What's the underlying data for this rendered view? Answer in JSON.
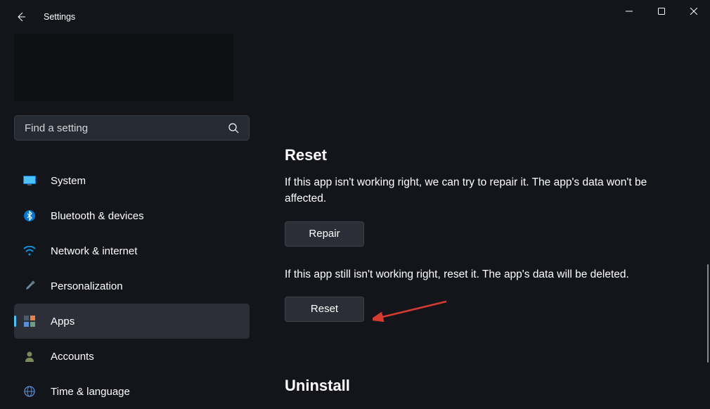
{
  "window": {
    "title": "Settings"
  },
  "search": {
    "placeholder": "Find a setting"
  },
  "nav": {
    "items": [
      {
        "label": "System",
        "icon": "monitor"
      },
      {
        "label": "Bluetooth & devices",
        "icon": "bluetooth"
      },
      {
        "label": "Network & internet",
        "icon": "wifi"
      },
      {
        "label": "Personalization",
        "icon": "brush"
      },
      {
        "label": "Apps",
        "icon": "apps",
        "selected": true
      },
      {
        "label": "Accounts",
        "icon": "person"
      },
      {
        "label": "Time & language",
        "icon": "globe"
      }
    ]
  },
  "reset": {
    "heading": "Reset",
    "repair_desc": "If this app isn't working right, we can try to repair it. The app's data won't be affected.",
    "repair_button": "Repair",
    "reset_desc": "If this app still isn't working right, reset it. The app's data will be deleted.",
    "reset_button": "Reset"
  },
  "uninstall": {
    "heading": "Uninstall"
  }
}
